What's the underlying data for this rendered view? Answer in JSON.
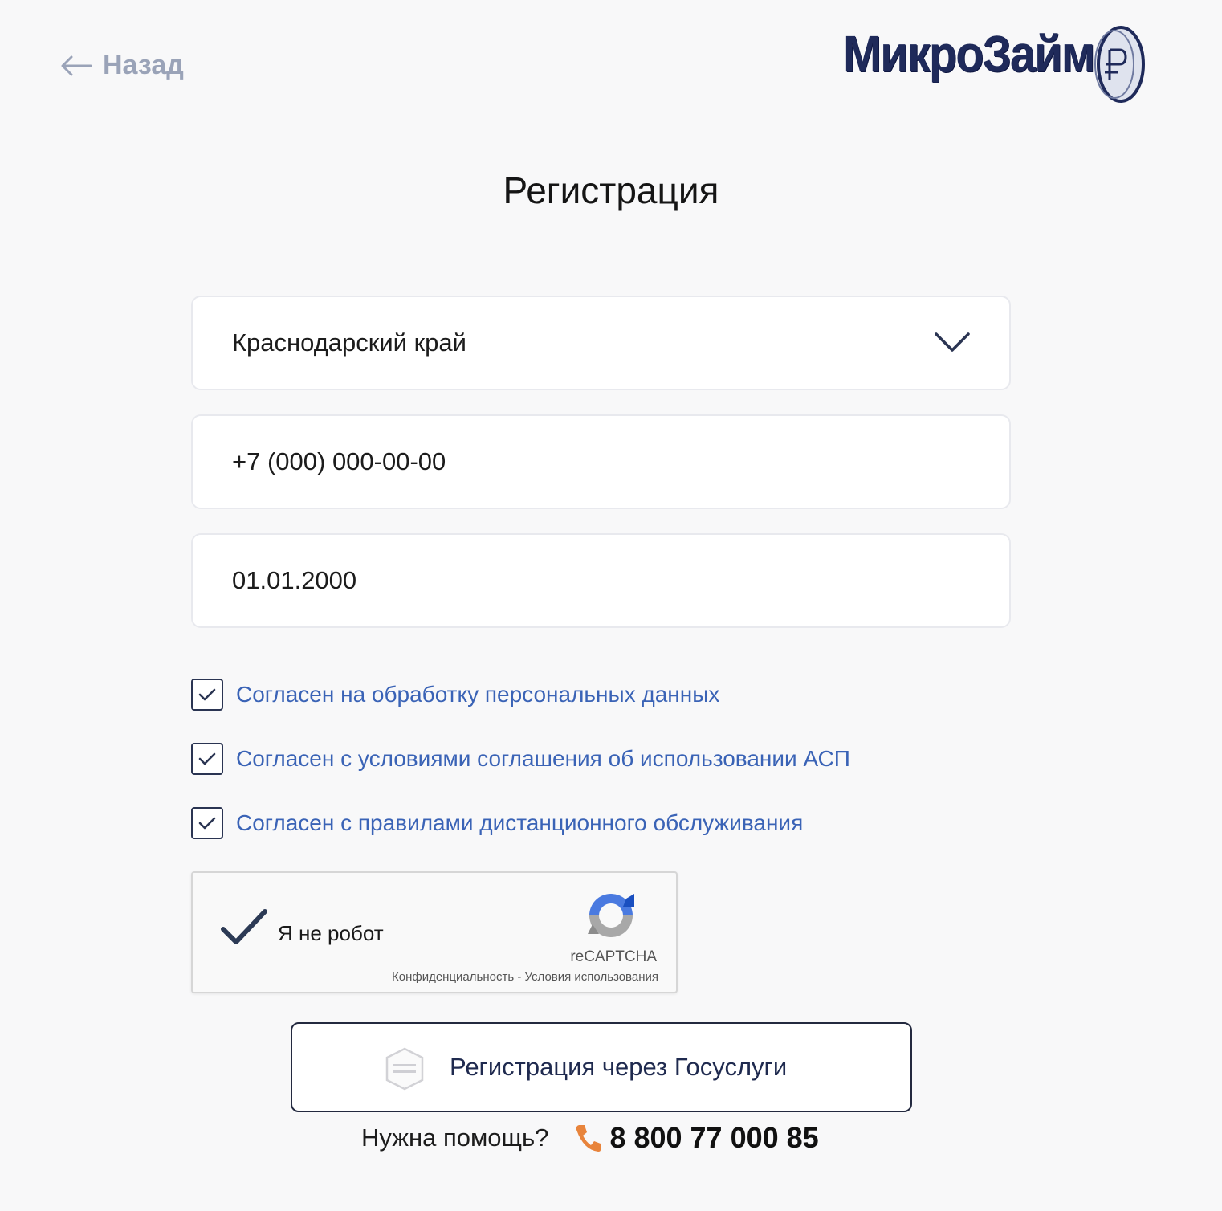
{
  "header": {
    "back_label": "Назад",
    "logo_text": "МикроЗайм"
  },
  "page": {
    "title": "Регистрация"
  },
  "form": {
    "region": {
      "value": "Краснодарский край"
    },
    "phone": {
      "placeholder": "+7 (000) 000-00-00"
    },
    "birthdate": {
      "placeholder": "01.01.2000"
    },
    "consents": [
      {
        "label": "Согласен на обработку персональных данных",
        "checked": true
      },
      {
        "label": "Согласен с условиями соглашения об использовании АСП",
        "checked": true
      },
      {
        "label": "Согласен с правилами дистанционного обслуживания",
        "checked": true
      }
    ]
  },
  "recaptcha": {
    "label": "Я не робот",
    "checked": true,
    "brand": "reCAPTCHA",
    "privacy_link": "Конфиденциальность",
    "separator": " - ",
    "terms_link": "Условия использования"
  },
  "gosuslugi_button": {
    "label": "Регистрация через Госуслуги",
    "icon": "gosuslugi-icon"
  },
  "help": {
    "text": "Нужна помощь?",
    "phone": "8 800 77 000 85",
    "icon": "phone-icon"
  },
  "colors": {
    "background": "#f8f8f9",
    "link_blue": "#3a63b6",
    "back_gray": "#9aa3b8",
    "logo_navy": "#1f2a5a",
    "phone_icon": "#e8843c"
  }
}
